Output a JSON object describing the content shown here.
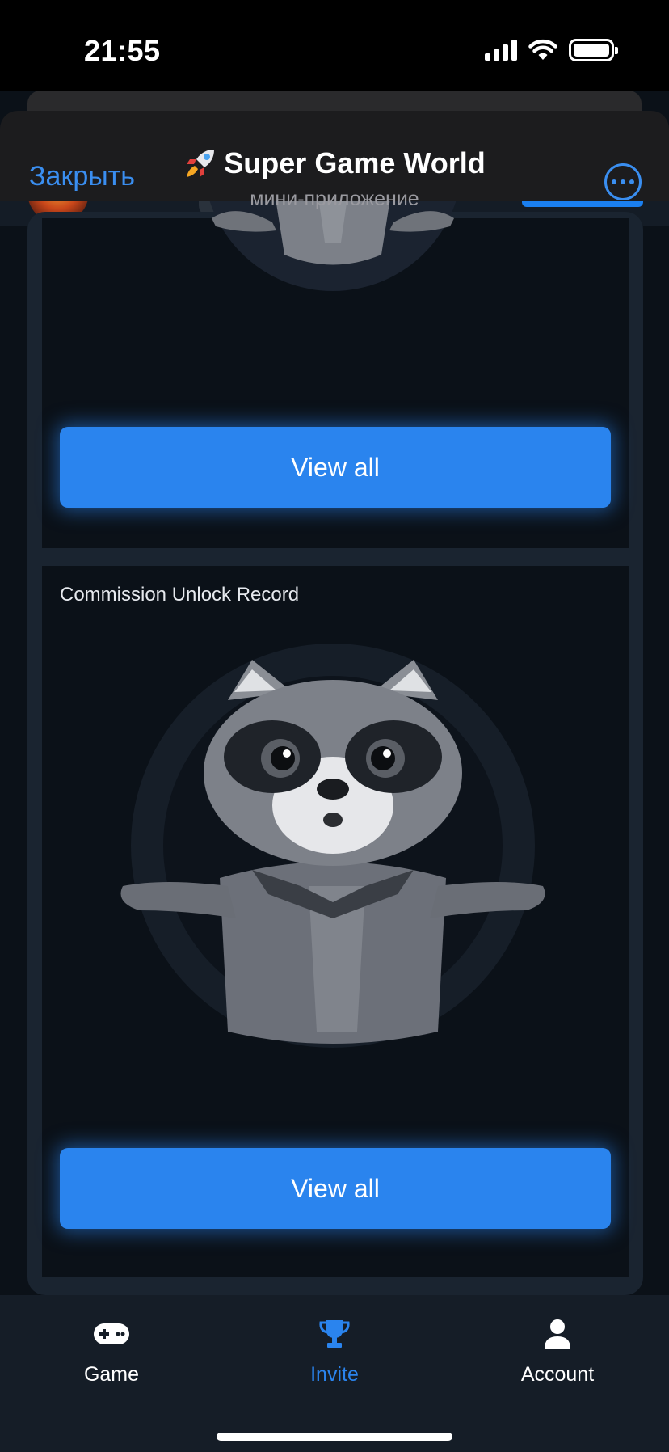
{
  "status_bar": {
    "time": "21:55"
  },
  "telegram_header": {
    "close_label": "Закрыть",
    "title": "Super Game World",
    "subtitle": "мини-приложение"
  },
  "content": {
    "card_top": {
      "button_label": "View all"
    },
    "card_commission": {
      "title": "Commission Unlock Record",
      "button_label": "View all"
    }
  },
  "bottom_nav": {
    "items": [
      {
        "label": "Game",
        "icon": "gamepad-icon",
        "active": false
      },
      {
        "label": "Invite",
        "icon": "trophy-icon",
        "active": true
      },
      {
        "label": "Account",
        "icon": "person-icon",
        "active": false
      }
    ]
  },
  "colors": {
    "accent": "#2a84ee",
    "telegram_link": "#3a8ef0",
    "background": "#0b1118",
    "panel": "#1a2430"
  }
}
